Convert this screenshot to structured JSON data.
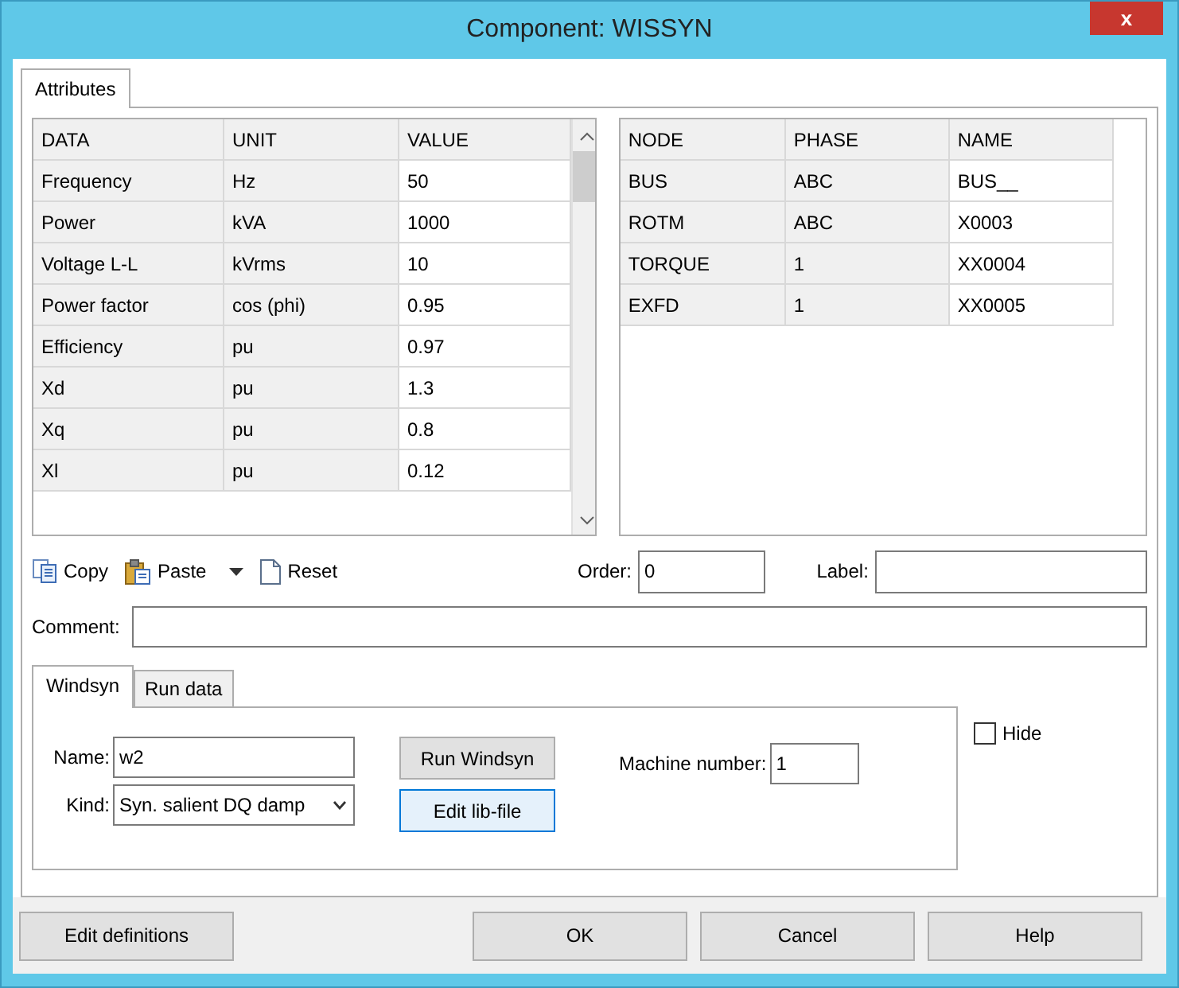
{
  "window": {
    "title": "Component: WISSYN",
    "close": "x"
  },
  "tabs": [
    {
      "label": "Attributes",
      "selected": true
    }
  ],
  "data_table": {
    "columns": [
      "DATA",
      "UNIT",
      "VALUE"
    ],
    "rows": [
      {
        "data": "Frequency",
        "unit": "Hz",
        "value": "50"
      },
      {
        "data": "Power",
        "unit": "kVA",
        "value": "1000"
      },
      {
        "data": "Voltage L-L",
        "unit": "kVrms",
        "value": "10"
      },
      {
        "data": "Power factor",
        "unit": "cos (phi)",
        "value": "0.95"
      },
      {
        "data": "Efficiency",
        "unit": "pu",
        "value": "0.97"
      },
      {
        "data": "Xd",
        "unit": "pu",
        "value": "1.3"
      },
      {
        "data": "Xq",
        "unit": "pu",
        "value": "0.8"
      },
      {
        "data": "Xl",
        "unit": "pu",
        "value": "0.12"
      }
    ]
  },
  "node_table": {
    "columns": [
      "NODE",
      "PHASE",
      "NAME"
    ],
    "rows": [
      {
        "node": "BUS",
        "phase": "ABC",
        "name": "BUS__"
      },
      {
        "node": "ROTM",
        "phase": "ABC",
        "name": "X0003"
      },
      {
        "node": "TORQUE",
        "phase": "1",
        "name": "XX0004"
      },
      {
        "node": "EXFD",
        "phase": "1",
        "name": "XX0005"
      }
    ]
  },
  "toolbar": [
    {
      "kind": "copy",
      "label": "Copy"
    },
    {
      "kind": "paste",
      "label": "Paste"
    },
    {
      "kind": "reset",
      "label": "Reset"
    }
  ],
  "order": {
    "label": "Order:",
    "value": "0"
  },
  "label_field": {
    "label": "Label:"
  },
  "comment": {
    "label": "Comment:"
  },
  "inner_tabs": [
    {
      "label": "Windsyn",
      "selected": true
    },
    {
      "label": "Run data",
      "selected": false
    }
  ],
  "name_field": {
    "label": "Name:",
    "value": "w2"
  },
  "kind_field": {
    "label": "Kind:",
    "value": "Syn. salient DQ damp"
  },
  "run_button": "Run Windsyn",
  "edit_lib_button": "Edit lib-file",
  "machine_number": {
    "label": "Machine number:",
    "value": "1"
  },
  "hide": {
    "label": "Hide",
    "checked": false
  },
  "footer_buttons": [
    "Edit definitions",
    "OK",
    "Cancel",
    "Help"
  ]
}
